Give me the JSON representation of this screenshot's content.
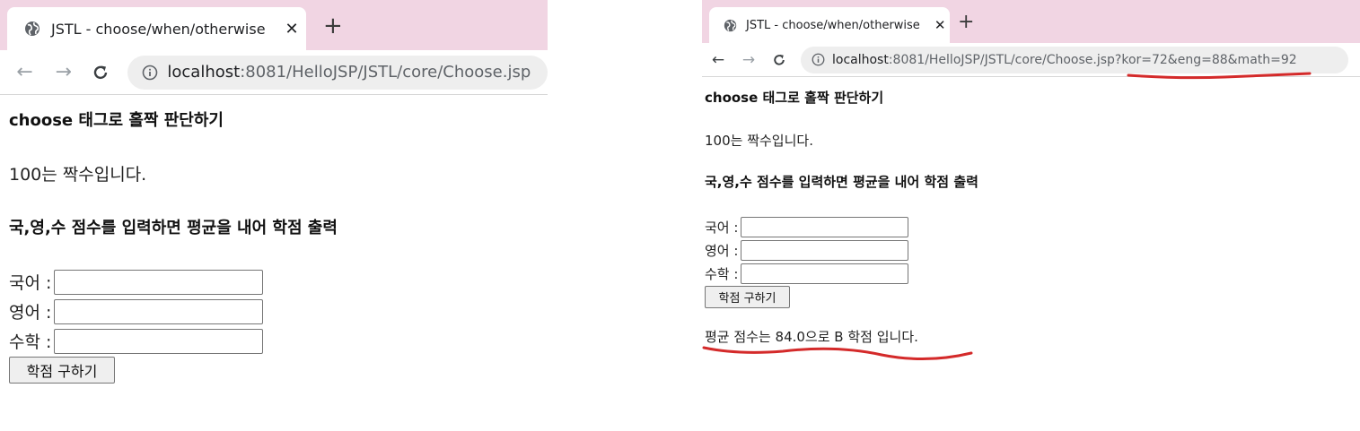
{
  "left": {
    "tab": {
      "title": "JSTL - choose/when/otherwise",
      "close": "✕",
      "new_tab": "+"
    },
    "nav": {
      "back": "←",
      "forward": "→",
      "reload": "C"
    },
    "address": {
      "host": "localhost",
      "rest": ":8081/HelloJSP/JSTL/core/Choose.jsp"
    },
    "page": {
      "title": "choose 태그로 홀짝 판단하기",
      "even_result": "100는 짝수입니다.",
      "subtitle": "국,영,수 점수를 입력하면 평균을 내어 학점 출력",
      "fields": [
        {
          "label": "국어 :",
          "value": ""
        },
        {
          "label": "영어 :",
          "value": ""
        },
        {
          "label": "수학 :",
          "value": ""
        }
      ],
      "submit": "학점 구하기"
    }
  },
  "right": {
    "tab": {
      "title": "JSTL - choose/when/otherwise",
      "close": "✕",
      "new_tab": "+"
    },
    "nav": {
      "back": "←",
      "forward": "→",
      "reload": "C"
    },
    "address": {
      "host": "localhost",
      "rest": ":8081/HelloJSP/JSTL/core/Choose.jsp?kor=72&eng=88&math=92"
    },
    "page": {
      "title": "choose 태그로 홀짝 판단하기",
      "even_result": "100는 짝수입니다.",
      "subtitle": "국,영,수 점수를 입력하면 평균을 내어 학점 출력",
      "fields": [
        {
          "label": "국어 :",
          "value": ""
        },
        {
          "label": "영어 :",
          "value": ""
        },
        {
          "label": "수학 :",
          "value": ""
        }
      ],
      "submit": "학점 구하기",
      "grade_result": "평균 점수는 84.0으로 B 학점 입니다."
    },
    "annotation_color": "#d42a2a"
  }
}
